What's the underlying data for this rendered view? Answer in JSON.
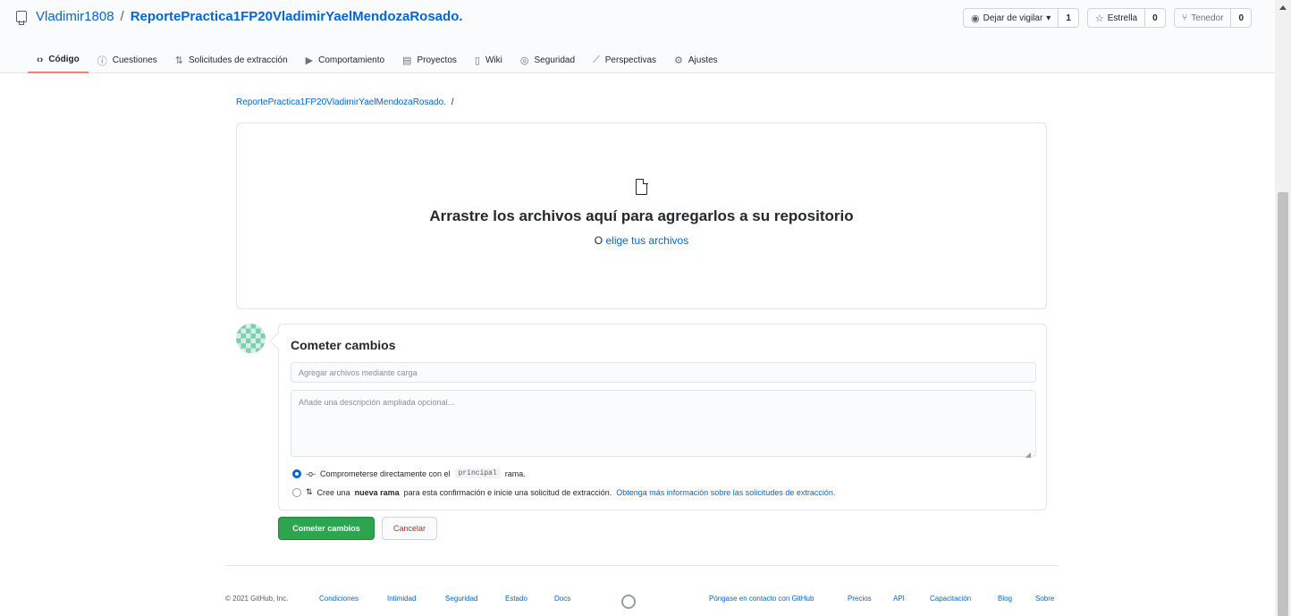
{
  "repo": {
    "owner": "Vladimir1808",
    "separator": "/",
    "name": "ReportePractica1FP20VladimirYaelMendozaRosado."
  },
  "actions": {
    "watch": {
      "label": "Dejar de vigilar",
      "caret": "▾",
      "count": "1"
    },
    "star": {
      "label": "Estrella",
      "count": "0"
    },
    "fork": {
      "label": "Tenedor",
      "count": "0"
    }
  },
  "tabs": [
    {
      "label": "Código",
      "icon": "‹›"
    },
    {
      "label": "Cuestiones",
      "icon": "ⓘ"
    },
    {
      "label": "Solicitudes de extracción",
      "icon": "⇅"
    },
    {
      "label": "Comportamiento",
      "icon": "▶"
    },
    {
      "label": "Proyectos",
      "icon": "▤"
    },
    {
      "label": "Wiki",
      "icon": "▯"
    },
    {
      "label": "Seguridad",
      "icon": "◎"
    },
    {
      "label": "Perspectivas",
      "icon": "⟋"
    },
    {
      "label": "Ajustes",
      "icon": "⚙"
    }
  ],
  "breadcrumb": {
    "repo": "ReportePractica1FP20VladimirYaelMendozaRosado.",
    "sep": "/"
  },
  "dropzone": {
    "title": "Arrastre los archivos aquí para agregarlos a su repositorio",
    "prefix": "O",
    "link": "elige tus archivos"
  },
  "commit": {
    "title": "Cometer cambios",
    "summary_placeholder": "Agregar archivos mediante carga",
    "description_placeholder": "Añade una descripción ampliada opcional...",
    "option1": {
      "prefix": "Comprometerse directamente con el",
      "branch": "principal",
      "suffix": "rama."
    },
    "option2": {
      "prefix": "Cree una",
      "bold": "nueva rama",
      "middle": "para esta confirmación e inicie una solicitud de extracción.",
      "link": "Obtenga más información sobre las solicitudes de extracción."
    },
    "submit_label": "Cometer cambios",
    "cancel_label": "Cancelar"
  },
  "footer": {
    "copyright": "© 2021 GitHub, Inc.",
    "left_links": [
      "Condiciones",
      "Intimidad",
      "Seguridad",
      "Estado",
      "Docs"
    ],
    "right_links": [
      "Póngase en contacto con GitHub",
      "Precios",
      "API",
      "Capacitación",
      "Blog",
      "Sobre"
    ]
  },
  "colors": {
    "link": "#0366d6",
    "primary_button": "#2ea44f",
    "cancel_text": "#cb2431",
    "active_tab_underline": "#f9826c"
  }
}
